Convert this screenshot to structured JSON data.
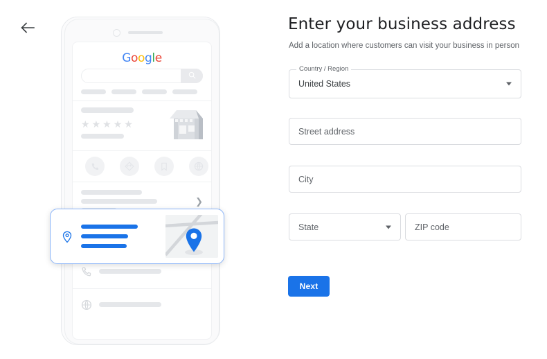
{
  "nav": {
    "back_icon": "arrow-left-icon"
  },
  "illustration": {
    "google_logo": [
      {
        "char": "G",
        "color": "#4285F4"
      },
      {
        "char": "o",
        "color": "#EA4335"
      },
      {
        "char": "o",
        "color": "#FBBC05"
      },
      {
        "char": "g",
        "color": "#4285F4"
      },
      {
        "char": "l",
        "color": "#34A853"
      },
      {
        "char": "e",
        "color": "#EA4335"
      }
    ],
    "search_icon": "search-icon",
    "store_icon": "storefront-icon",
    "rating_stars": 5,
    "star_icon": "star-icon",
    "chevron_icon": "chevron-right-icon",
    "action_icons": [
      "phone-icon",
      "directions-icon",
      "bookmark-icon",
      "globe-icon"
    ],
    "row_icons": [
      "clock-icon",
      "phone-icon",
      "globe-icon"
    ],
    "address_card": {
      "pin_icon": "location-pin-outline-icon",
      "map_pin_icon": "map-pin-filled-icon",
      "accent": "#1a73e8",
      "border": "#8ab4f8"
    }
  },
  "form": {
    "title": "Enter your business address",
    "subtitle": "Add a location where customers can visit your business in person",
    "country": {
      "legend": "Country / Region",
      "value": "United States",
      "caret_icon": "chevron-down-icon"
    },
    "street": {
      "placeholder": "Street address",
      "value": ""
    },
    "city": {
      "placeholder": "City",
      "value": ""
    },
    "state": {
      "placeholder": "State",
      "value": "",
      "caret_icon": "chevron-down-icon"
    },
    "zip": {
      "placeholder": "ZIP code",
      "value": ""
    },
    "next_label": "Next",
    "accent_color": "#1a73e8"
  }
}
